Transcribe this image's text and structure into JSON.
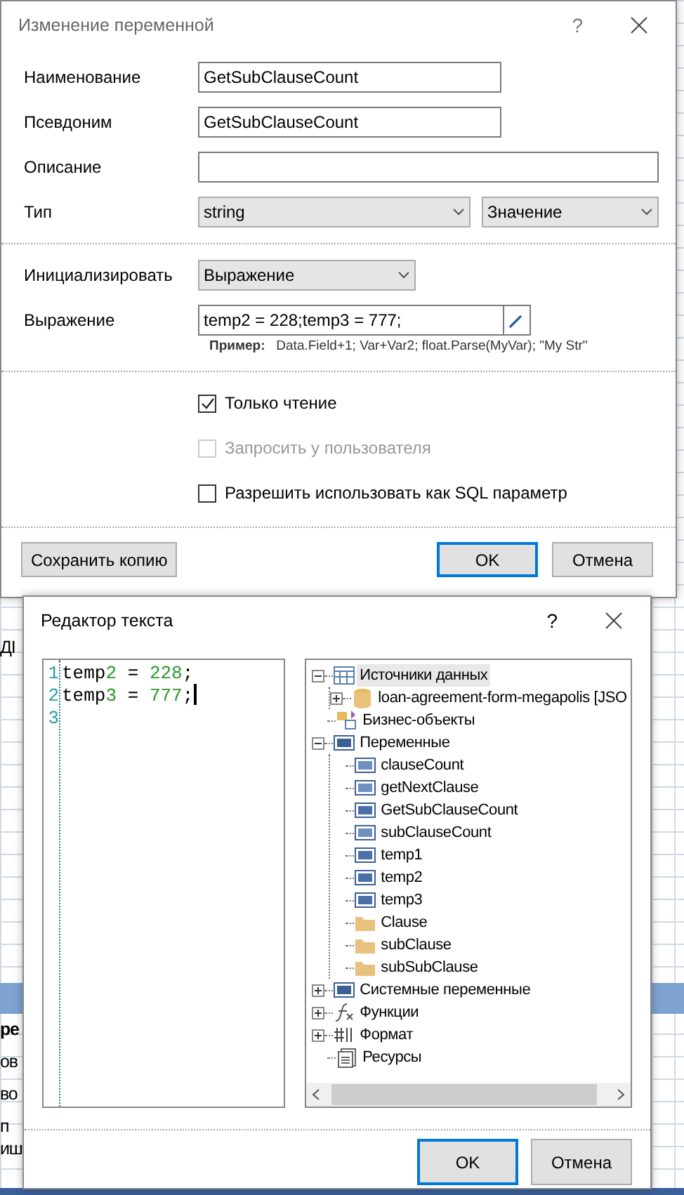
{
  "background": {
    "fragments": [
      {
        "text": "ДI",
        "kind": "plain"
      },
      {
        "text": "ре",
        "kind": "bold"
      },
      {
        "text": "ов",
        "kind": "plain"
      },
      {
        "text": "во",
        "kind": "plain"
      },
      {
        "text": "п",
        "kind": "plain"
      },
      {
        "text": "иш",
        "kind": "plain"
      }
    ]
  },
  "variable_dialog": {
    "title": "Изменение переменной",
    "help": "?",
    "fields": [
      {
        "kind": "text",
        "label": "Наименование",
        "value": "GetSubClauseCount"
      },
      {
        "kind": "text",
        "label": "Псевдоним",
        "value": "GetSubClauseCount"
      },
      {
        "kind": "wide",
        "label": "Описание"
      },
      {
        "kind": "combo-pair",
        "label": "Тип",
        "value": "string",
        "value_2": "Значение"
      }
    ],
    "init": {
      "label": "Инициализировать",
      "value": "Выражение"
    },
    "expression": {
      "label": "Выражение",
      "value": "temp2 = 228;temp3 = 777;",
      "example_label": "Пример:",
      "example": "Data.Field+1; Var+Var2; float.Parse(MyVar); \"My Str\""
    },
    "checkboxes": [
      {
        "label": "Только чтение",
        "checked": true,
        "disabled": false
      },
      {
        "label": "Запросить у пользователя",
        "checked": false,
        "disabled": true
      },
      {
        "label": "Разрешить использовать как SQL параметр",
        "checked": false,
        "disabled": false
      }
    ],
    "buttons": [
      {
        "label": "Сохранить копию",
        "default": false
      },
      {
        "label": "OK",
        "default": true
      },
      {
        "label": "Отмена",
        "default": false
      }
    ]
  },
  "editor_dialog": {
    "title": "Редактор текста",
    "help": "?",
    "lines": [
      {
        "number": "1",
        "code": "temp2 = 228;"
      },
      {
        "number": "2",
        "code": "temp3 = 777;",
        "cursor": true
      },
      {
        "number": "3"
      }
    ],
    "tree": [
      {
        "label": "Источники данных",
        "kind": "datasources",
        "expanded": true,
        "selected": true,
        "children": [
          {
            "label": "loan-agreement-form-megapolis [JSO",
            "kind": "database",
            "expanded": false,
            "selected": false
          }
        ]
      },
      {
        "label": "Бизнес-объекты",
        "kind": "business",
        "selected": false
      },
      {
        "label": "Переменные",
        "kind": "variables",
        "expanded": true,
        "selected": false,
        "children": [
          {
            "label": "clauseCount",
            "kind": "number",
            "selected": false
          },
          {
            "label": "getNextClause",
            "kind": "number",
            "selected": false
          },
          {
            "label": "GetSubClauseCount",
            "kind": "string",
            "selected": false
          },
          {
            "label": "subClauseCount",
            "kind": "number",
            "selected": false
          },
          {
            "label": "temp1",
            "kind": "string",
            "selected": false
          },
          {
            "label": "temp2",
            "kind": "string",
            "selected": false
          },
          {
            "label": "temp3",
            "kind": "string",
            "selected": false
          },
          {
            "label": "Clause",
            "kind": "folder",
            "selected": false
          },
          {
            "label": "subClause",
            "kind": "folder",
            "selected": false
          },
          {
            "label": "subSubClause",
            "kind": "folder",
            "selected": false
          }
        ]
      },
      {
        "label": "Системные переменные",
        "kind": "system",
        "expanded": false,
        "selected": false
      },
      {
        "label": "Функции",
        "kind": "functions",
        "expanded": false,
        "selected": false
      },
      {
        "label": "Формат",
        "kind": "format",
        "expanded": false,
        "selected": false
      },
      {
        "label": "Ресурсы",
        "kind": "resources",
        "selected": false
      }
    ],
    "buttons": [
      {
        "label": "OK",
        "default": true
      },
      {
        "label": "Отмена",
        "default": false
      }
    ]
  }
}
